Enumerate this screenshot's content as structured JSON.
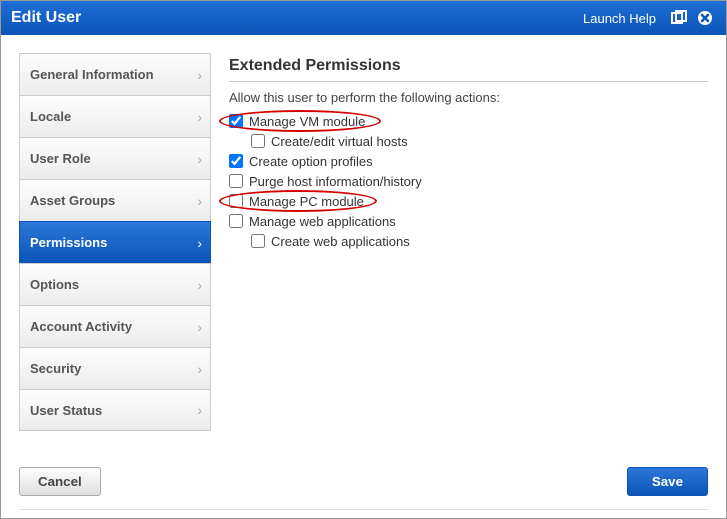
{
  "header": {
    "title": "Edit User",
    "help": "Launch Help"
  },
  "sidebar": {
    "items": [
      {
        "label": "General Information"
      },
      {
        "label": "Locale"
      },
      {
        "label": "User Role"
      },
      {
        "label": "Asset Groups"
      },
      {
        "label": "Permissions"
      },
      {
        "label": "Options"
      },
      {
        "label": "Account Activity"
      },
      {
        "label": "Security"
      },
      {
        "label": "User Status"
      }
    ],
    "active_index": 4
  },
  "content": {
    "heading": "Extended Permissions",
    "description": "Allow this user to perform the following actions:",
    "permissions": [
      {
        "label": "Manage VM module",
        "checked": true,
        "indent": false
      },
      {
        "label": "Create/edit virtual hosts",
        "checked": false,
        "indent": true
      },
      {
        "label": "Create option profiles",
        "checked": true,
        "indent": false
      },
      {
        "label": "Purge host information/history",
        "checked": false,
        "indent": false
      },
      {
        "label": "Manage PC module",
        "checked": false,
        "indent": false
      },
      {
        "label": "Manage web applications",
        "checked": false,
        "indent": false
      },
      {
        "label": "Create web applications",
        "checked": false,
        "indent": true
      }
    ]
  },
  "footer": {
    "cancel": "Cancel",
    "save": "Save"
  }
}
